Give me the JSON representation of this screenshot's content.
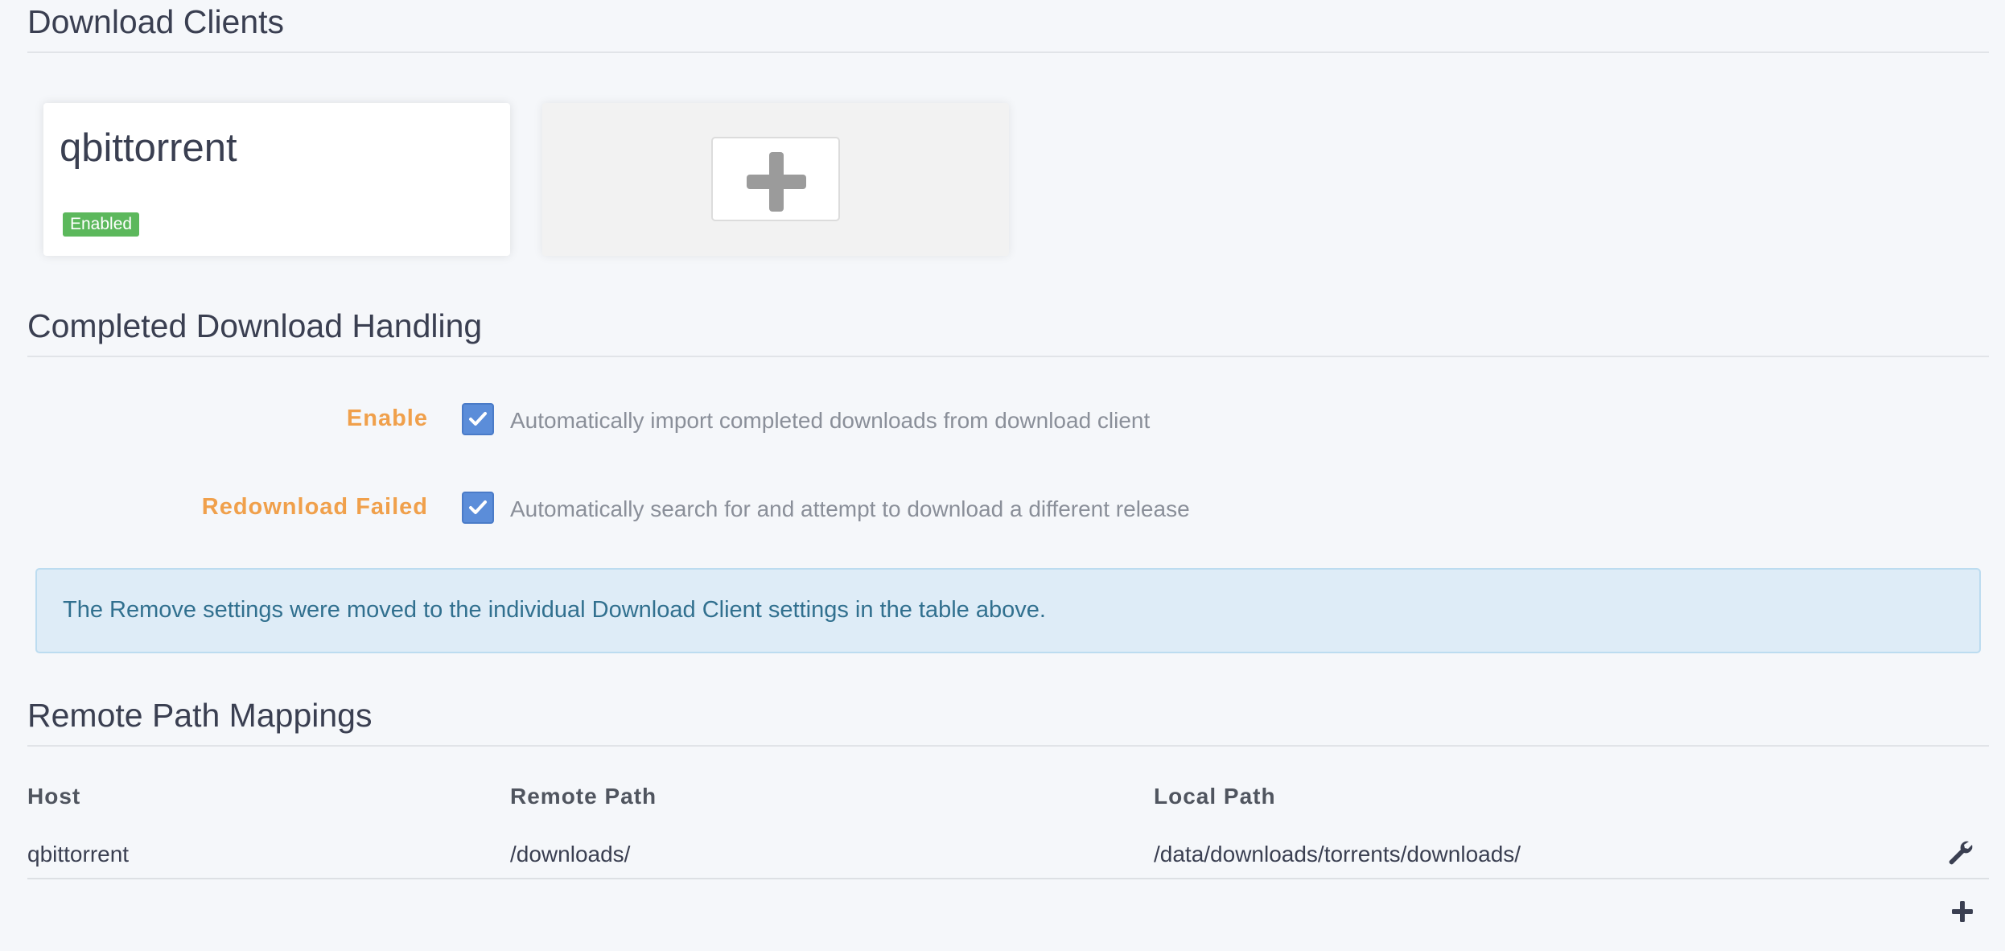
{
  "download_clients": {
    "title": "Download Clients",
    "clients": [
      {
        "name": "qbittorrent",
        "status": "Enabled"
      }
    ],
    "add_icon": "plus-icon"
  },
  "completed_download_handling": {
    "title": "Completed Download Handling",
    "enable": {
      "label": "Enable",
      "checked": true,
      "help": "Automatically import completed downloads from download client"
    },
    "redownload_failed": {
      "label": "Redownload Failed",
      "checked": true,
      "help": "Automatically search for and attempt to download a different release"
    },
    "info": "The Remove settings were moved to the individual Download Client settings in the table above."
  },
  "remote_path_mappings": {
    "title": "Remote Path Mappings",
    "columns": [
      "Host",
      "Remote Path",
      "Local Path"
    ],
    "rows": [
      {
        "host": "qbittorrent",
        "remote_path": "/downloads/",
        "local_path": "/data/downloads/torrents/downloads/",
        "edit_icon": "wrench-icon"
      }
    ],
    "add_icon": "plus-icon"
  },
  "colors": {
    "label_orange": "#f0a04b",
    "checkbox_blue": "#5b8dd9",
    "badge_green": "#5cb85c",
    "info_bg": "#deecf7",
    "info_text": "#31708f"
  }
}
